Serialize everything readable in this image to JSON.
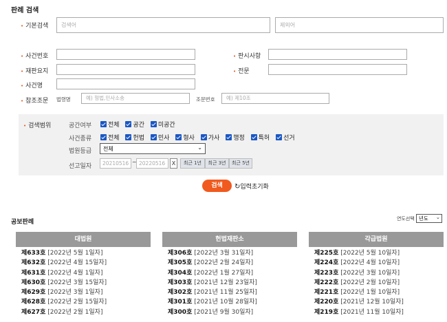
{
  "page_title": "판례 검색",
  "keyword": {
    "label": "기본검색",
    "placeholder": "검색어",
    "exclude_placeholder": "제외어"
  },
  "fields": {
    "case_no": "사건번호",
    "ruling_items": "판시사항",
    "summary": "재판요지",
    "full_text": "전문",
    "case_name": "사건명",
    "ref_label": "참조조문",
    "law_name_label": "법령명",
    "law_name_placeholder": "예) 형법,민사소송",
    "article_label": "조문번호",
    "article_placeholder": "예) 제10조"
  },
  "scope": {
    "label": "검색범위",
    "public_label": "공간여부",
    "public_options": [
      "전체",
      "공간",
      "미공간"
    ],
    "type_label": "사건종류",
    "type_options": [
      "전체",
      "헌법",
      "민사",
      "형사",
      "가사",
      "행정",
      "특허",
      "선거"
    ],
    "court_label": "법원등급",
    "court_selected": "전체",
    "date_label": "선고일자",
    "date_from": "20210516",
    "date_sep": "~",
    "date_to": "20220516",
    "clear": "X",
    "ranges": [
      "최근 1년",
      "최근 3년",
      "최근 5년"
    ]
  },
  "actions": {
    "search": "검색",
    "reset": "입력초기화"
  },
  "gazette": {
    "title": "공보판례",
    "year_label": "연도선택",
    "year_selected": "년도",
    "columns": [
      {
        "title": "대법원",
        "items": [
          {
            "no": "제633호",
            "date": "[2022년 5월 1일자]"
          },
          {
            "no": "제632호",
            "date": "[2022년 4월 15일자]"
          },
          {
            "no": "제631호",
            "date": "[2022년 4월 1일자]"
          },
          {
            "no": "제630호",
            "date": "[2022년 3월 15일자]"
          },
          {
            "no": "제629호",
            "date": "[2022년 3월 1일자]"
          },
          {
            "no": "제628호",
            "date": "[2022년 2월 15일자]"
          },
          {
            "no": "제627호",
            "date": "[2022년 2월 1일자]"
          }
        ]
      },
      {
        "title": "헌법재판소",
        "items": [
          {
            "no": "제306호",
            "date": "[2022년 3월 31일자]"
          },
          {
            "no": "제305호",
            "date": "[2022년 2월 24일자]"
          },
          {
            "no": "제304호",
            "date": "[2022년 1월 27일자]"
          },
          {
            "no": "제303호",
            "date": "[2021년 12월 23일자]"
          },
          {
            "no": "제302호",
            "date": "[2021년 11월 25일자]"
          },
          {
            "no": "제301호",
            "date": "[2021년 10월 28일자]"
          },
          {
            "no": "제300호",
            "date": "[2021년 9월 30일자]"
          }
        ]
      },
      {
        "title": "각급법원",
        "items": [
          {
            "no": "제225호",
            "date": "[2022년 5월 10일자]"
          },
          {
            "no": "제224호",
            "date": "[2022년 4월 10일자]"
          },
          {
            "no": "제223호",
            "date": "[2022년 3월 10일자]"
          },
          {
            "no": "제222호",
            "date": "[2022년 2월 10일자]"
          },
          {
            "no": "제221호",
            "date": "[2022년 1월 10일자]"
          },
          {
            "no": "제220호",
            "date": "[2021년 12월 10일자]"
          },
          {
            "no": "제219호",
            "date": "[2021년 11월 10일자]"
          }
        ]
      }
    ]
  }
}
